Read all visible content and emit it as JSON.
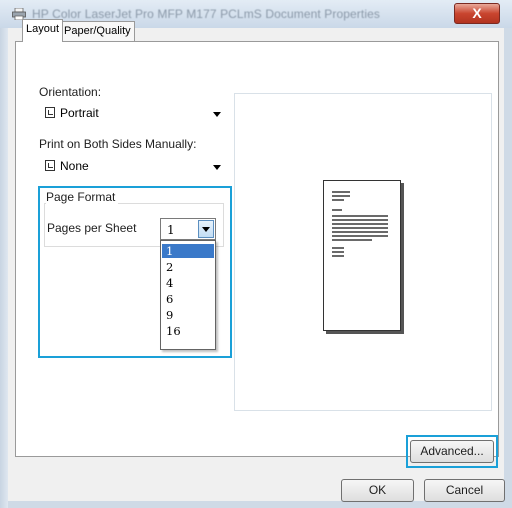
{
  "window": {
    "title": "HP Color LaserJet Pro MFP M177 PCLmS Document Properties",
    "close_label": "X"
  },
  "tabs": [
    {
      "label": "Layout",
      "active": true
    },
    {
      "label": "Paper/Quality",
      "active": false
    }
  ],
  "orientation": {
    "label": "Orientation:",
    "value": "Portrait"
  },
  "duplex": {
    "label": "Print on Both Sides Manually:",
    "value": "None"
  },
  "page_format": {
    "group_label": "Page Format",
    "pages_per_sheet_label": "Pages per Sheet",
    "pages_per_sheet_value": "1",
    "options": [
      "1",
      "2",
      "4",
      "6",
      "9",
      "16"
    ],
    "selected_option": "1"
  },
  "buttons": {
    "advanced": "Advanced...",
    "ok": "OK",
    "cancel": "Cancel"
  },
  "colors": {
    "highlight_outline": "#1aa0d8",
    "selection": "#3a79c9"
  }
}
